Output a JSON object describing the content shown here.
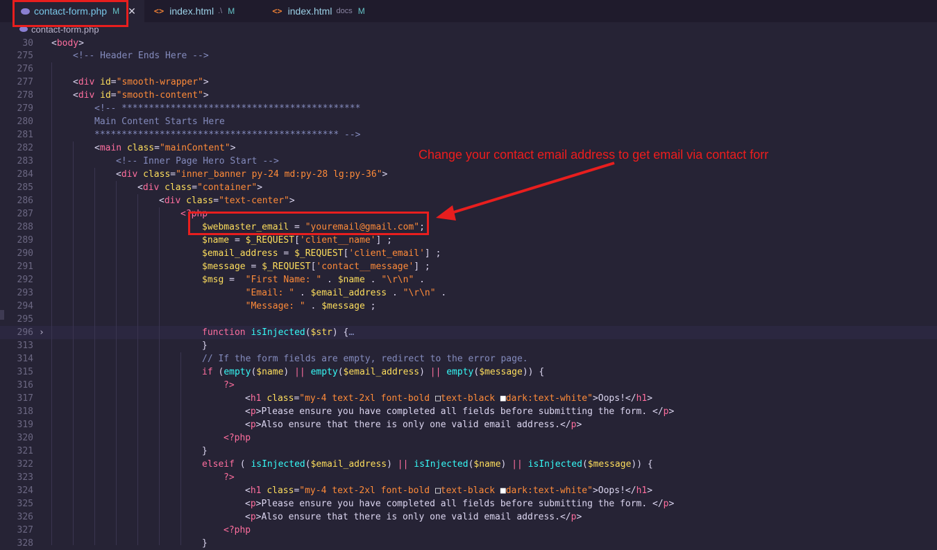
{
  "tabs": [
    {
      "name": "contact-form.php",
      "detail": "",
      "mod": "M",
      "close": "✕",
      "active": true,
      "icon": "php-elephant-icon"
    },
    {
      "name": "index.html",
      "detail": ".\\",
      "mod": "M",
      "close": "",
      "active": false,
      "icon": "html-code-icon"
    },
    {
      "name": "index.html",
      "detail": "docs",
      "mod": "M",
      "close": "",
      "active": false,
      "icon": "html-code-icon"
    }
  ],
  "breadcrumb": {
    "file": "contact-form.php",
    "icon": "php-elephant-icon"
  },
  "annotation": {
    "text": "Change your contact email address to get email via contact forr",
    "color": "#ee1d1d"
  },
  "colors": {
    "background": "#262335",
    "tag": "#fe6e9e",
    "attr": "#fede5d",
    "string": "#ff8b39",
    "variable": "#fede5d",
    "comment": "#848bbd",
    "func": "#36f9f6",
    "keyword": "#fe6e9e",
    "text": "#dcd6f0"
  },
  "lines": [
    {
      "n": "30",
      "indent": 0,
      "fold": "",
      "tokens": [
        [
          "p",
          "<"
        ],
        [
          "t",
          "body"
        ],
        [
          "p",
          ">"
        ]
      ]
    },
    {
      "n": "275",
      "indent": 1,
      "fold": "",
      "tokens": [
        [
          "c",
          "<!-- Header Ends Here -->"
        ]
      ]
    },
    {
      "n": "276",
      "indent": 0,
      "fold": "",
      "tokens": []
    },
    {
      "n": "277",
      "indent": 1,
      "fold": "",
      "tokens": [
        [
          "p",
          "<"
        ],
        [
          "t",
          "div"
        ],
        [
          "s",
          " "
        ],
        [
          "a",
          "id"
        ],
        [
          "p",
          "="
        ],
        [
          "v",
          "\"smooth-wrapper\""
        ],
        [
          "p",
          ">"
        ]
      ]
    },
    {
      "n": "278",
      "indent": 1,
      "fold": "",
      "tokens": [
        [
          "p",
          "<"
        ],
        [
          "t",
          "div"
        ],
        [
          "s",
          " "
        ],
        [
          "a",
          "id"
        ],
        [
          "p",
          "="
        ],
        [
          "v",
          "\"smooth-content\""
        ],
        [
          "p",
          ">"
        ]
      ]
    },
    {
      "n": "279",
      "indent": 2,
      "fold": "",
      "tokens": [
        [
          "c",
          "<!-- ********************************************"
        ]
      ]
    },
    {
      "n": "280",
      "indent": 2,
      "fold": "",
      "tokens": [
        [
          "c",
          "Main Content Starts Here"
        ]
      ]
    },
    {
      "n": "281",
      "indent": 2,
      "fold": "",
      "tokens": [
        [
          "c",
          "********************************************* -->"
        ]
      ]
    },
    {
      "n": "282",
      "indent": 2,
      "fold": "",
      "tokens": [
        [
          "p",
          "<"
        ],
        [
          "t",
          "main"
        ],
        [
          "s",
          " "
        ],
        [
          "a",
          "class"
        ],
        [
          "p",
          "="
        ],
        [
          "v",
          "\"mainContent\""
        ],
        [
          "p",
          ">"
        ]
      ]
    },
    {
      "n": "283",
      "indent": 3,
      "fold": "",
      "tokens": [
        [
          "c",
          "<!-- Inner Page Hero Start -->"
        ]
      ]
    },
    {
      "n": "284",
      "indent": 3,
      "fold": "",
      "tokens": [
        [
          "p",
          "<"
        ],
        [
          "t",
          "div"
        ],
        [
          "s",
          " "
        ],
        [
          "a",
          "class"
        ],
        [
          "p",
          "="
        ],
        [
          "v",
          "\"inner_banner py-24 md:py-28 lg:py-36\""
        ],
        [
          "p",
          ">"
        ]
      ]
    },
    {
      "n": "285",
      "indent": 4,
      "fold": "",
      "tokens": [
        [
          "p",
          "<"
        ],
        [
          "t",
          "div"
        ],
        [
          "s",
          " "
        ],
        [
          "a",
          "class"
        ],
        [
          "p",
          "="
        ],
        [
          "v",
          "\"container\""
        ],
        [
          "p",
          ">"
        ]
      ]
    },
    {
      "n": "286",
      "indent": 5,
      "fold": "",
      "tokens": [
        [
          "p",
          "<"
        ],
        [
          "t",
          "div"
        ],
        [
          "s",
          " "
        ],
        [
          "a",
          "class"
        ],
        [
          "p",
          "="
        ],
        [
          "v",
          "\"text-center\""
        ],
        [
          "p",
          ">"
        ]
      ]
    },
    {
      "n": "287",
      "indent": 6,
      "fold": "",
      "tokens": [
        [
          "k",
          "<?php"
        ]
      ]
    },
    {
      "n": "288",
      "indent": 7,
      "fold": "",
      "tokens": [
        [
          "x",
          "$webmaster_email"
        ],
        [
          "p",
          " = "
        ],
        [
          "v",
          "\"youremail@gmail.com\""
        ],
        [
          "p",
          ";"
        ]
      ]
    },
    {
      "n": "289",
      "indent": 7,
      "fold": "",
      "tokens": [
        [
          "x",
          "$name"
        ],
        [
          "p",
          " = "
        ],
        [
          "x",
          "$_REQUEST"
        ],
        [
          "p",
          "["
        ],
        [
          "v",
          "'client__name'"
        ],
        [
          "p",
          "] ;"
        ]
      ]
    },
    {
      "n": "290",
      "indent": 7,
      "fold": "",
      "tokens": [
        [
          "x",
          "$email_address"
        ],
        [
          "p",
          " = "
        ],
        [
          "x",
          "$_REQUEST"
        ],
        [
          "p",
          "["
        ],
        [
          "v",
          "'client_email'"
        ],
        [
          "p",
          "] ;"
        ]
      ]
    },
    {
      "n": "291",
      "indent": 7,
      "fold": "",
      "tokens": [
        [
          "x",
          "$message"
        ],
        [
          "p",
          " = "
        ],
        [
          "x",
          "$_REQUEST"
        ],
        [
          "p",
          "["
        ],
        [
          "v",
          "'contact__message'"
        ],
        [
          "p",
          "] ;"
        ]
      ]
    },
    {
      "n": "292",
      "indent": 7,
      "fold": "",
      "tokens": [
        [
          "x",
          "$msg"
        ],
        [
          "p",
          " =  "
        ],
        [
          "v",
          "\"First Name: \""
        ],
        [
          "p",
          " . "
        ],
        [
          "x",
          "$name"
        ],
        [
          "p",
          " . "
        ],
        [
          "v",
          "\"\\r\\n\""
        ],
        [
          "p",
          " ."
        ]
      ]
    },
    {
      "n": "293",
      "indent": 7,
      "fold": "",
      "tokens": [
        [
          "s",
          "        "
        ],
        [
          "v",
          "\"Email: \""
        ],
        [
          "p",
          " . "
        ],
        [
          "x",
          "$email_address"
        ],
        [
          "p",
          " . "
        ],
        [
          "v",
          "\"\\r\\n\""
        ],
        [
          "p",
          " ."
        ]
      ]
    },
    {
      "n": "294",
      "indent": 7,
      "fold": "",
      "tokens": [
        [
          "s",
          "        "
        ],
        [
          "v",
          "\"Message: \""
        ],
        [
          "p",
          " . "
        ],
        [
          "x",
          "$message"
        ],
        [
          "p",
          " ;"
        ]
      ]
    },
    {
      "n": "295",
      "indent": 0,
      "fold": "",
      "tokens": []
    },
    {
      "n": "296",
      "indent": 7,
      "fold": "›",
      "tokens": [
        [
          "k",
          "function"
        ],
        [
          "s",
          " "
        ],
        [
          "f",
          "isInjected"
        ],
        [
          "p",
          "("
        ],
        [
          "x",
          "$str"
        ],
        [
          "p",
          ") {"
        ],
        [
          "c",
          "…"
        ]
      ]
    },
    {
      "n": "313",
      "indent": 7,
      "fold": "",
      "tokens": [
        [
          "p",
          "}"
        ]
      ]
    },
    {
      "n": "314",
      "indent": 7,
      "fold": "",
      "tokens": [
        [
          "c",
          "// If the form fields are empty, redirect to the error page."
        ]
      ]
    },
    {
      "n": "315",
      "indent": 7,
      "fold": "",
      "tokens": [
        [
          "k",
          "if"
        ],
        [
          "p",
          " ("
        ],
        [
          "f",
          "empty"
        ],
        [
          "p",
          "("
        ],
        [
          "x",
          "$name"
        ],
        [
          "p",
          ") "
        ],
        [
          "k",
          "||"
        ],
        [
          "p",
          " "
        ],
        [
          "f",
          "empty"
        ],
        [
          "p",
          "("
        ],
        [
          "x",
          "$email_address"
        ],
        [
          "p",
          ") "
        ],
        [
          "k",
          "||"
        ],
        [
          "p",
          " "
        ],
        [
          "f",
          "empty"
        ],
        [
          "p",
          "("
        ],
        [
          "x",
          "$message"
        ],
        [
          "p",
          ")) {"
        ]
      ]
    },
    {
      "n": "316",
      "indent": 8,
      "fold": "",
      "tokens": [
        [
          "k",
          "?>"
        ]
      ]
    },
    {
      "n": "317",
      "indent": 9,
      "fold": "",
      "tokens": [
        [
          "p",
          "<"
        ],
        [
          "t",
          "h1"
        ],
        [
          "s",
          " "
        ],
        [
          "a",
          "class"
        ],
        [
          "p",
          "="
        ],
        [
          "v",
          "\"my-4 text-2xl font-bold "
        ],
        [
          "w",
          "□"
        ],
        [
          "v",
          "text-black "
        ],
        [
          "b",
          "■"
        ],
        [
          "v",
          "dark:text-white\""
        ],
        [
          "p",
          ">Oops!</"
        ],
        [
          "t",
          "h1"
        ],
        [
          "p",
          ">"
        ]
      ]
    },
    {
      "n": "318",
      "indent": 9,
      "fold": "",
      "tokens": [
        [
          "p",
          "<"
        ],
        [
          "t",
          "p"
        ],
        [
          "p",
          ">Please ensure you have completed all fields before submitting the form. </"
        ],
        [
          "t",
          "p"
        ],
        [
          "p",
          ">"
        ]
      ]
    },
    {
      "n": "319",
      "indent": 9,
      "fold": "",
      "tokens": [
        [
          "p",
          "<"
        ],
        [
          "t",
          "p"
        ],
        [
          "p",
          ">Also ensure that there is only one valid email address.</"
        ],
        [
          "t",
          "p"
        ],
        [
          "p",
          ">"
        ]
      ]
    },
    {
      "n": "320",
      "indent": 8,
      "fold": "",
      "tokens": [
        [
          "k",
          "<?php"
        ]
      ]
    },
    {
      "n": "321",
      "indent": 7,
      "fold": "",
      "tokens": [
        [
          "p",
          "}"
        ]
      ]
    },
    {
      "n": "322",
      "indent": 7,
      "fold": "",
      "tokens": [
        [
          "k",
          "elseif"
        ],
        [
          "p",
          " ( "
        ],
        [
          "f",
          "isInjected"
        ],
        [
          "p",
          "("
        ],
        [
          "x",
          "$email_address"
        ],
        [
          "p",
          ") "
        ],
        [
          "k",
          "||"
        ],
        [
          "p",
          " "
        ],
        [
          "f",
          "isInjected"
        ],
        [
          "p",
          "("
        ],
        [
          "x",
          "$name"
        ],
        [
          "p",
          ") "
        ],
        [
          "k",
          "||"
        ],
        [
          "p",
          " "
        ],
        [
          "f",
          "isInjected"
        ],
        [
          "p",
          "("
        ],
        [
          "x",
          "$message"
        ],
        [
          "p",
          ")) {"
        ]
      ]
    },
    {
      "n": "323",
      "indent": 8,
      "fold": "",
      "tokens": [
        [
          "k",
          "?>"
        ]
      ]
    },
    {
      "n": "324",
      "indent": 9,
      "fold": "",
      "tokens": [
        [
          "p",
          "<"
        ],
        [
          "t",
          "h1"
        ],
        [
          "s",
          " "
        ],
        [
          "a",
          "class"
        ],
        [
          "p",
          "="
        ],
        [
          "v",
          "\"my-4 text-2xl font-bold "
        ],
        [
          "w",
          "□"
        ],
        [
          "v",
          "text-black "
        ],
        [
          "b",
          "■"
        ],
        [
          "v",
          "dark:text-white\""
        ],
        [
          "p",
          ">Oops!</"
        ],
        [
          "t",
          "h1"
        ],
        [
          "p",
          ">"
        ]
      ]
    },
    {
      "n": "325",
      "indent": 9,
      "fold": "",
      "tokens": [
        [
          "p",
          "<"
        ],
        [
          "t",
          "p"
        ],
        [
          "p",
          ">Please ensure you have completed all fields before submitting the form. </"
        ],
        [
          "t",
          "p"
        ],
        [
          "p",
          ">"
        ]
      ]
    },
    {
      "n": "326",
      "indent": 9,
      "fold": "",
      "tokens": [
        [
          "p",
          "<"
        ],
        [
          "t",
          "p"
        ],
        [
          "p",
          ">Also ensure that there is only one valid email address.</"
        ],
        [
          "t",
          "p"
        ],
        [
          "p",
          ">"
        ]
      ]
    },
    {
      "n": "327",
      "indent": 8,
      "fold": "",
      "tokens": [
        [
          "k",
          "<?php"
        ]
      ]
    },
    {
      "n": "328",
      "indent": 7,
      "fold": "",
      "tokens": [
        [
          "p",
          "}"
        ]
      ]
    }
  ]
}
